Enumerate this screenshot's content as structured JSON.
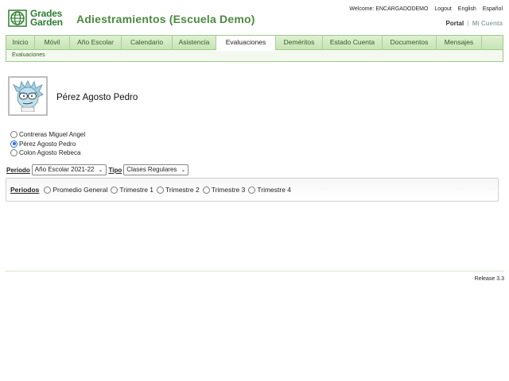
{
  "header": {
    "logo_line1": "Grades",
    "logo_line2": "Garden",
    "title": "Adiestramientos (Escuela Demo)",
    "welcome": "Welcome: ENCARGADODEMO",
    "logout": "Logout",
    "english": "English",
    "espanol": "Español",
    "portal": "Portal",
    "separator": "|",
    "mi_cuenta": "Mi Cuenta"
  },
  "nav": {
    "tabs": [
      {
        "label": "Inicio"
      },
      {
        "label": "Móvil"
      },
      {
        "label": "Año Escolar"
      },
      {
        "label": "Calendario"
      },
      {
        "label": "Asistencia"
      },
      {
        "label": "Evaluaciones"
      },
      {
        "label": "Deméritos"
      },
      {
        "label": "Estado Cuenta"
      },
      {
        "label": "Documentos"
      },
      {
        "label": "Mensajes"
      }
    ],
    "active_tab": "Evaluaciones",
    "sub": "Evaluaciones"
  },
  "profile": {
    "name": "Pérez Agosto Pedro"
  },
  "students": [
    {
      "name": "Contreras Miguel Angel",
      "selected": false
    },
    {
      "name": "Pérez Agosto Pedro",
      "selected": true
    },
    {
      "name": "Colon Agosto Rebeca",
      "selected": false
    }
  ],
  "filters": {
    "periodo_label": "Periodo",
    "periodo_value": "Año Escolar 2021-22",
    "tipo_label": "Tipo",
    "tipo_value": "Clases Regulares"
  },
  "periods": {
    "label": "Periodos",
    "options": [
      "Promedio General",
      "Trimestre 1",
      "Trimestre 2",
      "Trimestre 3",
      "Trimestre 4"
    ]
  },
  "footer": {
    "release": "Release 3.3"
  },
  "colors": {
    "brand_green": "#4a8a3c",
    "tab_bg": "#c7e4b5",
    "radio_blue": "#2b6cd6"
  }
}
